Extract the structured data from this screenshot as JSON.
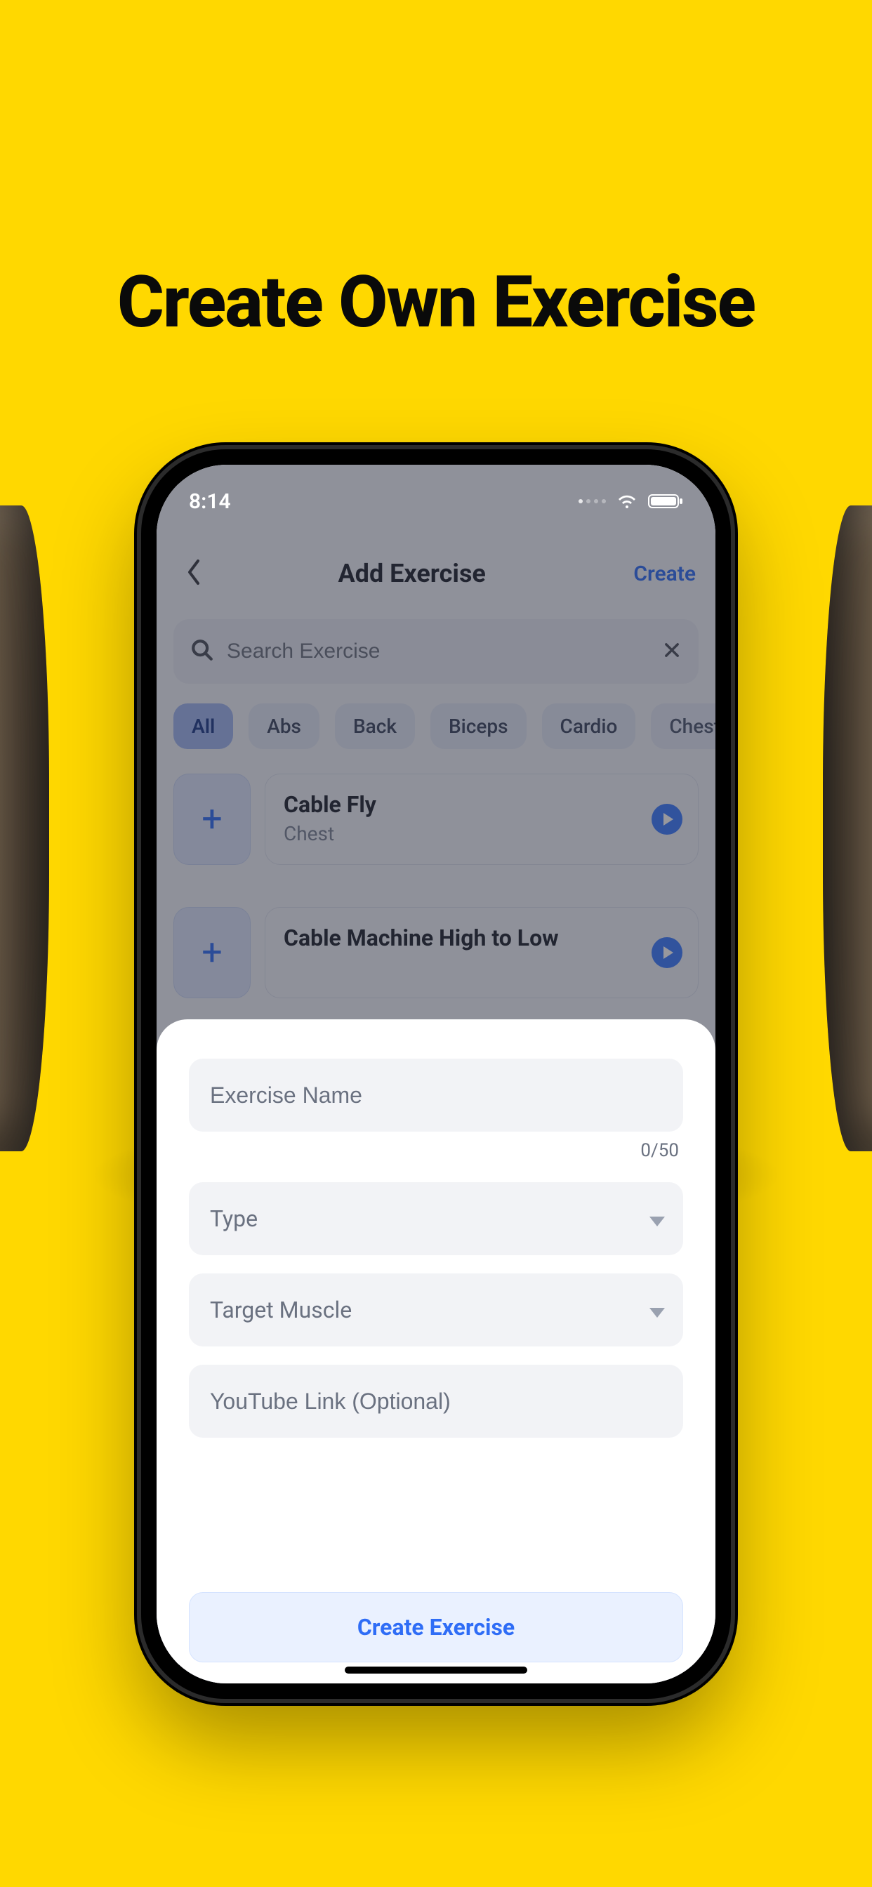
{
  "promo": {
    "title": "Create Own Exercise"
  },
  "status": {
    "time": "8:14"
  },
  "nav": {
    "title": "Add Exercise",
    "action": "Create"
  },
  "search": {
    "placeholder": "Search Exercise"
  },
  "chips": [
    "All",
    "Abs",
    "Back",
    "Biceps",
    "Cardio",
    "Chest"
  ],
  "active_chip_index": 0,
  "exercises": [
    {
      "name": "Cable Fly",
      "muscle": "Chest"
    },
    {
      "name": "Cable Machine High to Low",
      "muscle": ""
    }
  ],
  "sheet": {
    "name_placeholder": "Exercise Name",
    "name_counter": "0/50",
    "type_label": "Type",
    "target_label": "Target Muscle",
    "youtube_placeholder": "YouTube Link (Optional)",
    "submit": "Create Exercise"
  }
}
